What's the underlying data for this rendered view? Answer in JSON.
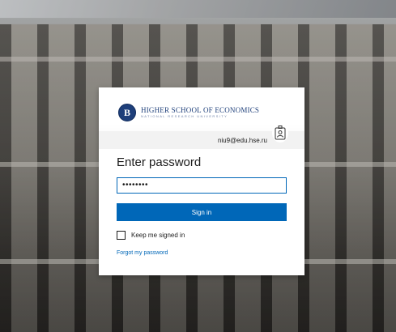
{
  "branding": {
    "seal_letter": "B",
    "org_name": "HIGHER SCHOOL OF ECONOMICS",
    "org_subtitle": "NATIONAL RESEARCH UNIVERSITY",
    "brand_color": "#1e3f7a"
  },
  "account": {
    "email": "niu9@edu.hse.ru",
    "icon": "account-badge-icon"
  },
  "form": {
    "heading": "Enter password",
    "password_value": "••••••••",
    "signin_label": "Sign in",
    "keep_signed_in_label": "Keep me signed in",
    "keep_signed_in_checked": false,
    "forgot_password_label": "Forgot my password"
  },
  "colors": {
    "accent": "#0067b8",
    "background_overlay": "building photo"
  }
}
